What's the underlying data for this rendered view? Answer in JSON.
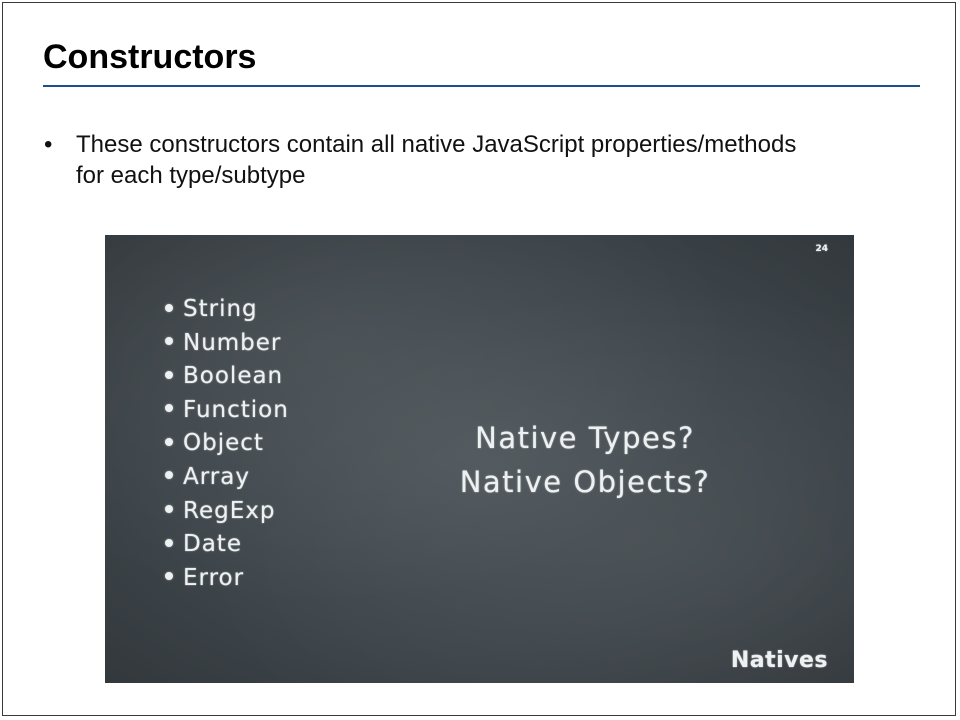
{
  "slide": {
    "title": "Constructors",
    "bullets": [
      "These constructors contain all native JavaScript properties/methods for each type/subtype"
    ],
    "bullet_char": "•"
  },
  "image": {
    "slide_number": "24",
    "types": [
      "String",
      "Number",
      "Boolean",
      "Function",
      "Object",
      "Array",
      "RegExp",
      "Date",
      "Error"
    ],
    "question_line_1": "Native Types?",
    "question_line_2": "Native Objects?",
    "footer": "Natives"
  },
  "colors": {
    "title_rule": "#1f4e8c",
    "chalkboard": "#40474c",
    "chalk": "#eef1f2"
  }
}
